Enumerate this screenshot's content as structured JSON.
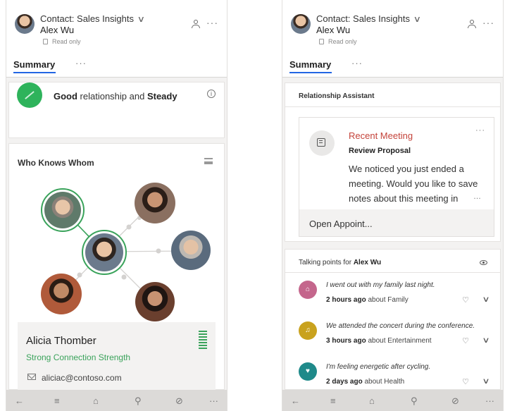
{
  "header": {
    "contact_label": "Contact: Sales Insights",
    "name": "Alex Wu",
    "read_only": "Read only",
    "tab": "Summary"
  },
  "icons": {
    "chevron": "chevron-down-icon",
    "more": "more-icon",
    "person": "person-icon",
    "lock": "lock-icon",
    "list": "list-icon",
    "info": "info-icon",
    "eye": "eye-icon",
    "calendar": "calendar-icon",
    "heart": "heart-icon"
  },
  "symbols": {
    "chevron": "∨",
    "more": "···",
    "info": "i",
    "ellipsis": "…",
    "heart": "♡"
  },
  "relationship": {
    "quality": "Good",
    "middle": " relationship and ",
    "trend": "Steady"
  },
  "who_knows_whom": {
    "title": "Who Knows Whom",
    "selected": {
      "name": "Alicia Thomber",
      "strength": "Strong Connection Strength",
      "email": "aliciac@contoso.com"
    }
  },
  "relationship_assistant": {
    "title": "Relationship Assistant",
    "card": {
      "kind": "Recent Meeting",
      "subject": "Review Proposal",
      "body": "We noticed you just ended a meeting. Would you like to save notes about this meeting in",
      "action": "Open Appoint..."
    }
  },
  "talking_points": {
    "title_prefix": "Talking points for ",
    "title_name": "Alex Wu",
    "items": [
      {
        "quote": "I went out with my family last night.",
        "time": "2 hours ago",
        "about": " about ",
        "topic": "Family",
        "color": "#c4668c",
        "icon_name": "family-icon"
      },
      {
        "quote": "We attended the concert during the conference.",
        "time": "3 hours ago",
        "about": " about ",
        "topic": "Entertainment",
        "color": "#c9a21e",
        "icon_name": "entertainment-icon"
      },
      {
        "quote": "I'm feeling energetic after cycling.",
        "time": "2 days ago",
        "about": " about ",
        "topic": "Health",
        "color": "#1f8a8a",
        "icon_name": "health-icon"
      }
    ]
  },
  "bottom_nav": [
    {
      "name": "back-icon",
      "glyph": "←"
    },
    {
      "name": "menu-icon",
      "glyph": "≡"
    },
    {
      "name": "home-icon",
      "glyph": "⌂"
    },
    {
      "name": "search-icon",
      "glyph": "⚲"
    },
    {
      "name": "compose-icon",
      "glyph": "⊘"
    },
    {
      "name": "more-icon",
      "glyph": "···"
    }
  ],
  "colors": {
    "accent": "#2266e3",
    "good": "#2eb35b",
    "strength": "#3aa35b",
    "meeting": "#c4433a"
  }
}
